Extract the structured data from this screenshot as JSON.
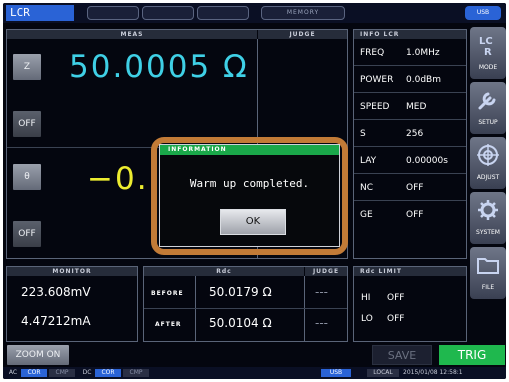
{
  "topbar": {
    "title": "LCR",
    "memory_label": "MEMORY",
    "usb_label": "USB"
  },
  "meas": {
    "header": "MEAS",
    "judge_header": "JUDGE",
    "param1_label": "Z",
    "param1_value": "50.0005 Ω",
    "off1_label": "OFF",
    "param2_label": "θ",
    "param2_value": "−0.",
    "off2_label": "OFF"
  },
  "info_lcr": {
    "header": "INFO LCR",
    "rows": [
      {
        "key": "FREQ",
        "value": "1.0MHz"
      },
      {
        "key": "POWER",
        "value": "0.0dBm"
      },
      {
        "key": "SPEED",
        "value": "MED"
      },
      {
        "key": "S",
        "value": "256"
      },
      {
        "key": "LAY",
        "value": "0.00000s"
      },
      {
        "key": "NC",
        "value": "OFF"
      },
      {
        "key": "GE",
        "value": "OFF"
      }
    ]
  },
  "side": {
    "mode": "MODE",
    "setup": "SETUP",
    "adjust": "ADJUST",
    "system": "SYSTEM",
    "file": "FILE"
  },
  "monitor": {
    "header": "MONITOR",
    "voltage": "223.608mV",
    "current": "4.47212mA"
  },
  "rdc": {
    "header": "Rdc",
    "judge_header": "JUDGE",
    "before_label": "BEFORE",
    "before_value": "50.0179 Ω",
    "before_judge": "---",
    "after_label": "AFTER",
    "after_value": "50.0104 Ω",
    "after_judge": "---"
  },
  "rdc_limit": {
    "header": "Rdc LIMIT",
    "hi_label": "HI",
    "hi_value": "OFF",
    "lo_label": "LO",
    "lo_value": "OFF"
  },
  "bottom": {
    "zoom_label": "ZOOM ON",
    "save_label": "SAVE",
    "trig_label": "TRIG"
  },
  "statusbar": {
    "ac_label": "AC",
    "cor1": "COR",
    "cmp1": "CMP",
    "dc_label": "DC",
    "cor2": "COR",
    "cmp2": "CMP",
    "usb": "USB",
    "local": "LOCAL",
    "datetime": "2015/01/08 12:58:1"
  },
  "dialog": {
    "header": "INFORMATION",
    "message": "Warm up completed.",
    "ok_label": "OK"
  },
  "colors": {
    "accent_blue": "#2a63d6",
    "primary_value": "#3fd0e6",
    "secondary_value": "#ecec30",
    "trig_green": "#1fb84e",
    "dialog_frame": "#c27b37"
  }
}
